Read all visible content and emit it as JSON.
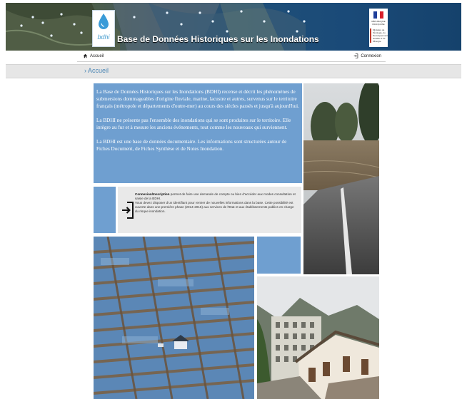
{
  "banner": {
    "logo_text": "bdhi",
    "title": "Base de Données Historiques sur les Inondations",
    "republique_text": "RÉPUBLIQUE FRANÇAISE",
    "ministere_text": "Ministère de l'Écologie, du Développement durable et de l'Énergie"
  },
  "nav": {
    "home_label": "Accueil",
    "login_label": "Connexion"
  },
  "breadcrumb": {
    "current": "Accueil"
  },
  "intro": {
    "paragraphs": [
      "La Base de Données Historiques sur les Inondations (BDHI) recense et décrit les phénomènes de submersions dommageables d'origine fluviale, marine, lacustre et autres, survenus sur le territoire français (métropole et départements d'outre-mer) au cours des siècles passés et jusqu'à aujourd'hui.",
      "La BDHI ne présente pas l'ensemble des inondations qui se sont produites sur le territoire. Elle intègre au fur et à mesure les anciens événements, tout comme les nouveaux qui surviennent.",
      "La BDHI est une base de données documentaire. Les informations sont structurées autour de Fiches Document, de Fiches Synthèse et de Notes Inondation."
    ]
  },
  "connexion": {
    "title": "Connexion/Inscription",
    "line1": " permet de faire une demande de compte ou bien d'accéder aux modes consultation et saisie de la BDHI.",
    "line2": "Vous devez disposer d'un identifiant pour rentrer de nouvelles informations dans la base. Cette possibilité est ouverte dans une première phase (2014-2015) aux services de l'Etat et aux établissements publics en charge du risque inondation."
  },
  "colors": {
    "accent_blue": "#6f9fd0",
    "breadcrumb_blue": "#4b86b4",
    "panel_grey": "#e9e9e9"
  }
}
